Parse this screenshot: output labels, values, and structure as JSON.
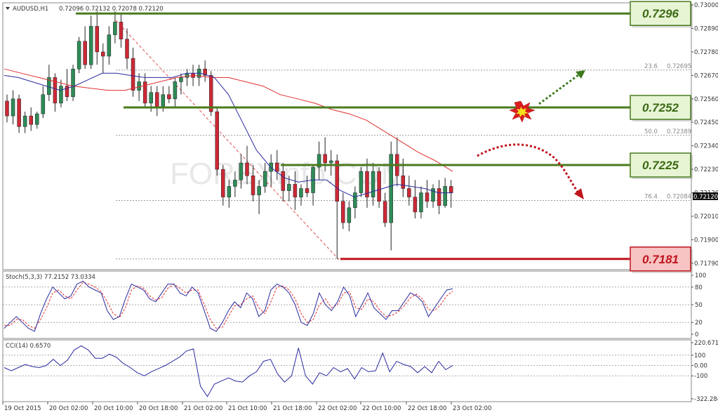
{
  "header": {
    "symbol": "AUDUSD,H1",
    "ohlc": "0.72096 0.72132 0.72078 0.72120"
  },
  "watermark": "FOREXinfo.COM",
  "price_tag": "0.72120",
  "levels": [
    {
      "label": "0.7296",
      "value": 0.7296,
      "kind": "resistance"
    },
    {
      "label": "0.7252",
      "value": 0.7252,
      "kind": "resistance"
    },
    {
      "label": "0.7225",
      "value": 0.7225,
      "kind": "resistance"
    },
    {
      "label": "0.7181",
      "value": 0.7181,
      "kind": "support"
    }
  ],
  "fib_levels": [
    {
      "ratio": "23.6",
      "price": "0.72695",
      "value": 0.72695
    },
    {
      "ratio": "50.0",
      "price": "0.72389",
      "value": 0.72389
    },
    {
      "ratio": "76.4",
      "price": "0.72084",
      "value": 0.72084
    }
  ],
  "colors": {
    "bull_candle": "#2e8b57",
    "bear_candle": "#cc2936",
    "resistance": "#4a7a1e",
    "support": "#c0141c",
    "ma_slow": "#e03030",
    "ma_fast": "#2a2aa0"
  },
  "chart_data": [
    {
      "type": "candlestick",
      "title": "AUDUSD,H1",
      "ylim": [
        0.7176,
        0.7301
      ],
      "y_ticks": [
        "0.73000",
        "0.72890",
        "0.72780",
        "0.72670",
        "0.72560",
        "0.72450",
        "0.72340",
        "0.72230",
        "0.72120",
        "0.72010",
        "0.71900",
        "0.71790"
      ],
      "x_ticks": [
        "19 Oct 2015",
        "20 Oct 02:00",
        "20 Oct 10:00",
        "20 Oct 18:00",
        "21 Oct 02:00",
        "21 Oct 10:00",
        "21 Oct 18:00",
        "22 Oct 02:00",
        "22 Oct 10:00",
        "22 Oct 18:00",
        "23 Oct 02:00"
      ],
      "ohlc": [
        [
          0.7255,
          0.7258,
          0.7245,
          0.7248
        ],
        [
          0.7248,
          0.726,
          0.7244,
          0.7256
        ],
        [
          0.7256,
          0.7258,
          0.724,
          0.7243
        ],
        [
          0.7243,
          0.725,
          0.724,
          0.7248
        ],
        [
          0.7248,
          0.7252,
          0.7241,
          0.7244
        ],
        [
          0.7244,
          0.725,
          0.7242,
          0.7249
        ],
        [
          0.7249,
          0.7262,
          0.7247,
          0.7258
        ],
        [
          0.7258,
          0.7272,
          0.7255,
          0.7266
        ],
        [
          0.7266,
          0.7268,
          0.725,
          0.7254
        ],
        [
          0.7254,
          0.7265,
          0.7252,
          0.7262
        ],
        [
          0.7262,
          0.727,
          0.7255,
          0.7257
        ],
        [
          0.7257,
          0.7272,
          0.7255,
          0.727
        ],
        [
          0.727,
          0.7285,
          0.7268,
          0.7283
        ],
        [
          0.7283,
          0.729,
          0.727,
          0.7272
        ],
        [
          0.7272,
          0.7295,
          0.727,
          0.729
        ],
        [
          0.729,
          0.7297,
          0.7272,
          0.7278
        ],
        [
          0.7278,
          0.7282,
          0.7268,
          0.7276
        ],
        [
          0.7276,
          0.729,
          0.7272,
          0.7286
        ],
        [
          0.7286,
          0.7297,
          0.7282,
          0.7292
        ],
        [
          0.7292,
          0.7296,
          0.728,
          0.7284
        ],
        [
          0.7284,
          0.7289,
          0.727,
          0.7275
        ],
        [
          0.7275,
          0.728,
          0.7257,
          0.726
        ],
        [
          0.726,
          0.7268,
          0.7255,
          0.7264
        ],
        [
          0.7264,
          0.7268,
          0.7252,
          0.7254
        ],
        [
          0.7254,
          0.7262,
          0.725,
          0.7259
        ],
        [
          0.7259,
          0.7262,
          0.7248,
          0.7252
        ],
        [
          0.7252,
          0.7262,
          0.725,
          0.7258
        ],
        [
          0.7258,
          0.7262,
          0.7254,
          0.7256
        ],
        [
          0.7256,
          0.7266,
          0.7252,
          0.7264
        ],
        [
          0.7264,
          0.7268,
          0.7258,
          0.7266
        ],
        [
          0.7266,
          0.727,
          0.7262,
          0.7268
        ],
        [
          0.7268,
          0.7272,
          0.7262,
          0.7266
        ],
        [
          0.7266,
          0.7272,
          0.7262,
          0.727
        ],
        [
          0.727,
          0.7274,
          0.7264,
          0.7267
        ],
        [
          0.7267,
          0.7269,
          0.7248,
          0.725
        ],
        [
          0.725,
          0.7252,
          0.722,
          0.7223
        ],
        [
          0.7223,
          0.7225,
          0.7206,
          0.721
        ],
        [
          0.721,
          0.7218,
          0.7205,
          0.7215
        ],
        [
          0.7215,
          0.7222,
          0.721,
          0.7218
        ],
        [
          0.7218,
          0.723,
          0.7214,
          0.7226
        ],
        [
          0.7226,
          0.7234,
          0.7216,
          0.722
        ],
        [
          0.722,
          0.7225,
          0.7208,
          0.7211
        ],
        [
          0.7211,
          0.7218,
          0.7202,
          0.7215
        ],
        [
          0.7215,
          0.7226,
          0.7212,
          0.7222
        ],
        [
          0.7222,
          0.723,
          0.7215,
          0.7226
        ],
        [
          0.7226,
          0.7232,
          0.7218,
          0.7222
        ],
        [
          0.7222,
          0.7226,
          0.7208,
          0.7213
        ],
        [
          0.7213,
          0.722,
          0.7208,
          0.7216
        ],
        [
          0.7216,
          0.7222,
          0.7204,
          0.721
        ],
        [
          0.721,
          0.7216,
          0.7206,
          0.7214
        ],
        [
          0.7214,
          0.722,
          0.721,
          0.7212
        ],
        [
          0.7212,
          0.7225,
          0.7206,
          0.7224
        ],
        [
          0.7224,
          0.7236,
          0.7218,
          0.723
        ],
        [
          0.723,
          0.7238,
          0.7222,
          0.7226
        ],
        [
          0.7226,
          0.7232,
          0.722,
          0.7227
        ],
        [
          0.7227,
          0.723,
          0.7181,
          0.7208
        ],
        [
          0.7208,
          0.7212,
          0.7195,
          0.7198
        ],
        [
          0.7198,
          0.7208,
          0.7194,
          0.7205
        ],
        [
          0.7205,
          0.7215,
          0.72,
          0.7212
        ],
        [
          0.7212,
          0.7224,
          0.721,
          0.7222
        ],
        [
          0.7222,
          0.7228,
          0.7205,
          0.721
        ],
        [
          0.721,
          0.7226,
          0.7206,
          0.7222
        ],
        [
          0.7222,
          0.7224,
          0.7205,
          0.7208
        ],
        [
          0.7208,
          0.7212,
          0.7196,
          0.7198
        ],
        [
          0.7198,
          0.7236,
          0.7185,
          0.723
        ],
        [
          0.723,
          0.7238,
          0.7215,
          0.722
        ],
        [
          0.722,
          0.7228,
          0.721,
          0.7214
        ],
        [
          0.7214,
          0.722,
          0.7206,
          0.721
        ],
        [
          0.721,
          0.7218,
          0.72,
          0.7203
        ],
        [
          0.7203,
          0.7215,
          0.72,
          0.7212
        ],
        [
          0.7212,
          0.7218,
          0.7205,
          0.7208
        ],
        [
          0.7208,
          0.7216,
          0.7205,
          0.7214
        ],
        [
          0.7214,
          0.7218,
          0.7202,
          0.7206
        ],
        [
          0.7206,
          0.7219,
          0.7205,
          0.7215
        ],
        [
          0.7215,
          0.7218,
          0.7205,
          0.7212
        ]
      ],
      "ma_slow": [
        0.727,
        0.7268,
        0.7266,
        0.7264,
        0.7262,
        0.7261,
        0.726,
        0.726,
        0.7262,
        0.7264,
        0.7266,
        0.7267,
        0.7266,
        0.7266,
        0.7264,
        0.7262,
        0.7258,
        0.7256,
        0.7254,
        0.7251,
        0.7249,
        0.7246,
        0.7241,
        0.7236,
        0.7231,
        0.7227,
        0.7222
      ],
      "ma_fast": [
        0.7267,
        0.7266,
        0.7264,
        0.7262,
        0.726,
        0.7262,
        0.7265,
        0.7268,
        0.7268,
        0.7267,
        0.7266,
        0.7266,
        0.7266,
        0.7268,
        0.7268,
        0.7266,
        0.7258,
        0.7245,
        0.7232,
        0.7224,
        0.7219,
        0.7217,
        0.7218,
        0.7218,
        0.7213,
        0.721,
        0.7212,
        0.7214,
        0.7216,
        0.7215,
        0.7214,
        0.7212,
        0.7212
      ]
    },
    {
      "type": "line",
      "title": "Stoch(5,3,3) 77.2152 73.0334",
      "ylim": [
        0,
        100
      ],
      "y_ticks": [
        "100",
        "80",
        "50",
        "20",
        "0"
      ],
      "series": [
        {
          "values": [
            10,
            20,
            30,
            20,
            10,
            5,
            35,
            60,
            80,
            70,
            60,
            65,
            85,
            90,
            80,
            75,
            70,
            40,
            25,
            30,
            60,
            85,
            80,
            75,
            60,
            55,
            70,
            85,
            85,
            70,
            65,
            80,
            70,
            40,
            10,
            5,
            20,
            40,
            55,
            45,
            70,
            60,
            30,
            40,
            75,
            85,
            80,
            70,
            50,
            20,
            15,
            35,
            70,
            50,
            40,
            55,
            80,
            65,
            30,
            50,
            70,
            45,
            35,
            25,
            40,
            40,
            55,
            70,
            65,
            55,
            30,
            45,
            60,
            75,
            77.2
          ]
        },
        {
          "values": [
            15,
            15,
            25,
            25,
            15,
            10,
            25,
            45,
            70,
            75,
            65,
            60,
            75,
            88,
            85,
            80,
            72,
            55,
            35,
            28,
            45,
            75,
            82,
            78,
            65,
            58,
            62,
            78,
            85,
            78,
            70,
            75,
            75,
            50,
            25,
            10,
            12,
            30,
            48,
            50,
            60,
            65,
            45,
            35,
            55,
            80,
            82,
            75,
            60,
            35,
            20,
            25,
            50,
            60,
            45,
            50,
            70,
            72,
            45,
            42,
            60,
            55,
            40,
            30,
            32,
            38,
            48,
            62,
            68,
            60,
            42,
            40,
            50,
            65,
            73.0
          ]
        }
      ]
    },
    {
      "type": "line",
      "title": "CCI(14) 0.6570",
      "ylim": [
        -322.284,
        220.671
      ],
      "y_ticks": [
        "220.671",
        "100",
        "0.00",
        "-100",
        "-322.284"
      ],
      "series": [
        {
          "values": [
            -20,
            -50,
            -20,
            10,
            -10,
            -20,
            0,
            60,
            0,
            50,
            150,
            190,
            150,
            70,
            70,
            110,
            80,
            20,
            -20,
            -70,
            -100,
            -60,
            -30,
            0,
            40,
            80,
            140,
            160,
            -200,
            -300,
            -180,
            -150,
            -120,
            -150,
            -160,
            -100,
            -60,
            40,
            60,
            -80,
            -160,
            -100,
            170,
            -100,
            -180,
            -70,
            -100,
            -20,
            -60,
            -30,
            -130,
            -20,
            -60,
            -50,
            120,
            -60,
            40,
            10,
            -10,
            -70,
            -10,
            -70,
            40,
            -40,
            0.657
          ]
        }
      ]
    }
  ]
}
